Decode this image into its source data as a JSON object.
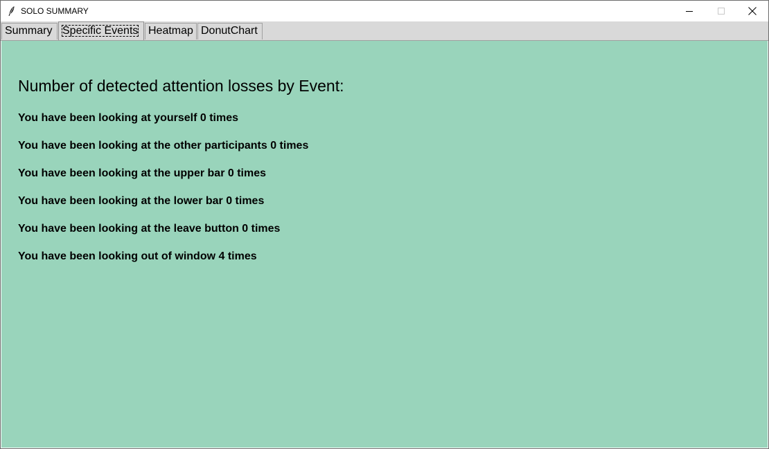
{
  "window": {
    "title": "SOLO SUMMARY",
    "icons": {
      "app": "feather-icon",
      "minimize": "minimize-icon",
      "maximize": "maximize-icon",
      "close": "close-icon"
    }
  },
  "tabs": [
    {
      "label": "Summary",
      "selected": false
    },
    {
      "label": "Specific Events",
      "selected": true
    },
    {
      "label": "Heatmap",
      "selected": false
    },
    {
      "label": "DonutChart",
      "selected": false
    }
  ],
  "content": {
    "background": "#99d4bb",
    "heading": "Number of detected attention losses by Event:",
    "events": [
      "You have been looking at yourself 0 times",
      "You have been looking at the other participants 0 times",
      "You have been looking at the upper bar 0 times",
      "You have been looking at the lower bar 0 times",
      "You have been looking at the leave button 0 times",
      "You have been looking out of window 4 times"
    ]
  }
}
